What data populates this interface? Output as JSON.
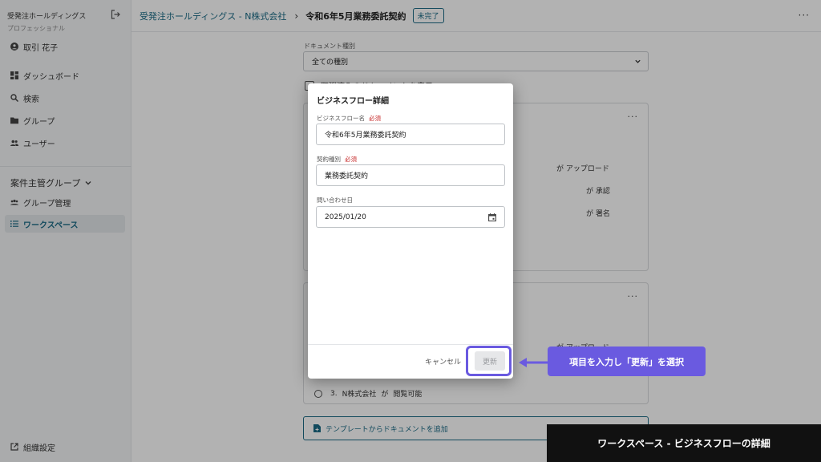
{
  "sidebar": {
    "org_name": "受発注ホールディングス",
    "org_plan": "プロフェッショナル",
    "user_name": "取引 花子",
    "items": [
      {
        "label": "ダッシュボード"
      },
      {
        "label": "検索"
      },
      {
        "label": "グループ"
      },
      {
        "label": "ユーザー"
      }
    ],
    "group_heading": "案件主管グループ",
    "group_items": [
      {
        "label": "グループ管理"
      },
      {
        "label": "ワークスペース"
      }
    ],
    "org_settings": "組織設定"
  },
  "header": {
    "breadcrumb_link": "受発注ホールディングス - N株式会社",
    "breadcrumb_sep": "›",
    "current": "令和6年5月業務委託契約",
    "status_badge": "未完了",
    "more": "···"
  },
  "main": {
    "doc_type_label": "ドキュメント種別",
    "doc_type_value": "全ての種別",
    "checkbox_label": "取消済みのドキュメントを表示",
    "card1_rows": [
      {
        "action": "が アップロード"
      },
      {
        "action": "が 承認"
      },
      {
        "action": "が 署名"
      }
    ],
    "card2_partial": "が アップロード",
    "step3": {
      "num": "3.",
      "company": "N株式会社",
      "ga": "が",
      "action": "閲覧可能"
    },
    "template_button": "テンプレートからドキュメントを追加",
    "more": "···"
  },
  "modal": {
    "title": "ビジネスフロー詳細",
    "required": "必須",
    "fields": {
      "flow_name": {
        "label": "ビジネスフロー名",
        "value": "令和6年5月業務委託契約"
      },
      "contract_type": {
        "label": "契約種別",
        "value": "業務委託契約"
      },
      "inquiry_date": {
        "label": "問い合わせ日",
        "value": "2025/01/20"
      }
    },
    "cancel": "キャンセル",
    "update": "更新"
  },
  "callout": "項目を入力し「更新」を選択",
  "caption": "ワークスペース - ビジネスフローの詳細",
  "colors": {
    "accent": "#1b6b86",
    "highlight": "#6a5ae0",
    "required": "#c62828"
  }
}
